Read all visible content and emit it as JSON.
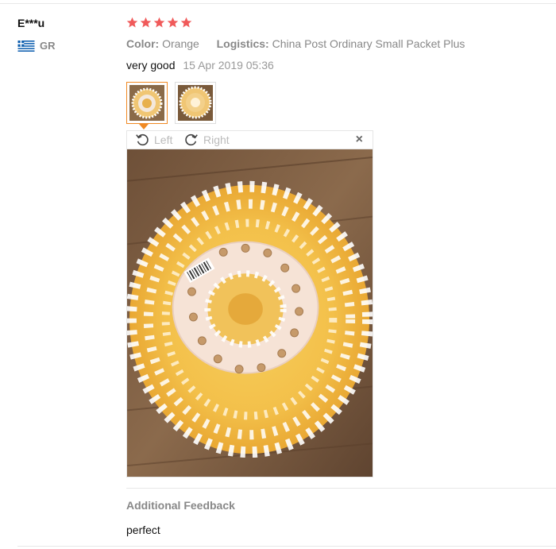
{
  "review": {
    "user": "E***u",
    "country_code": "GR",
    "country_flag_icon": "greece-flag-icon",
    "rating": 5,
    "rating_max": 5,
    "star_color": "#f05a5a",
    "color_label": "Color:",
    "color_value": "Orange",
    "logistics_label": "Logistics:",
    "logistics_value": "China Post Ordinary Small Packet Plus",
    "comment": "very good",
    "date": "15 Apr 2019 05:36",
    "photos": [
      {
        "icon": "mop-head-thumbnail",
        "active": true
      },
      {
        "icon": "mop-head-thumbnail",
        "active": false
      }
    ]
  },
  "viewer": {
    "rotate_left_label": "Left",
    "rotate_right_label": "Right",
    "close_glyph": "×",
    "accent_color": "#f08a24"
  },
  "additional_feedback": {
    "title": "Additional Feedback",
    "text": "perfect"
  }
}
